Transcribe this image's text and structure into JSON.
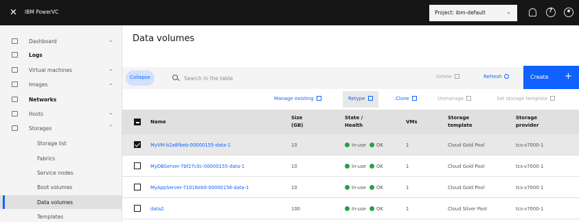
{
  "header": {
    "app_name": "IBM PowerVC",
    "project_label": "Project: ibm-default",
    "icons": [
      "close-icon",
      "notification-icon",
      "help-icon",
      "user-icon"
    ]
  },
  "sidebar": {
    "items": [
      {
        "label": "Dashboard",
        "icon": "dashboard-icon",
        "expandable": true
      },
      {
        "label": "Logs",
        "icon": "logs-icon",
        "expandable": false
      },
      {
        "label": "Virtual machines",
        "icon": "vm-icon",
        "expandable": true
      },
      {
        "label": "Images",
        "icon": "images-icon",
        "expandable": true
      },
      {
        "label": "Networks",
        "icon": "network-icon",
        "expandable": false
      },
      {
        "label": "Hosts",
        "icon": "hosts-icon",
        "expandable": true
      },
      {
        "label": "Storages",
        "icon": "storage-icon",
        "expandable": true,
        "expanded": true
      }
    ],
    "sub_items": [
      {
        "label": "Storage list"
      },
      {
        "label": "Fabrics"
      },
      {
        "label": "Service nodes"
      },
      {
        "label": "Boot volumes"
      },
      {
        "label": "Data volumes",
        "active": true
      },
      {
        "label": "Templates"
      }
    ]
  },
  "main": {
    "title": "Data volumes",
    "collect_label": "Collapse",
    "search_placeholder": "Search in the table",
    "delete_label": "Delete",
    "refresh_label": "Refresh",
    "create_label": "Create",
    "create_icon": "+",
    "actions": {
      "manage_existing": "Manage existing",
      "retype": "Retype",
      "clone": "Clone",
      "unmanage": "Unmanage",
      "set_storage_template": "Set storage template"
    }
  },
  "table": {
    "columns": [
      {
        "label": "Name"
      },
      {
        "label": "Size (GB)"
      },
      {
        "label": "State / Health"
      },
      {
        "label": "VMs"
      },
      {
        "label": "Storage template"
      },
      {
        "label": "Storage provider"
      }
    ],
    "rows": [
      {
        "name": "MyVM-b2a8fbeb-00000155-data-1",
        "size": "10",
        "state": "In-use",
        "health": "OK",
        "vms": "1",
        "template": "Cloud Gold Pool",
        "provider": "tcs-v7000-1",
        "selected": true
      },
      {
        "name": "MyDBServer-7bf27c0c-00000155-data-1",
        "size": "10",
        "state": "In-use",
        "health": "OK",
        "vms": "1",
        "template": "Cloud Gold Pool",
        "provider": "tcs-v7000-1",
        "selected": false
      },
      {
        "name": "MyAppServer-71016eb0-00000156-data-1",
        "size": "10",
        "state": "In-use",
        "health": "OK",
        "vms": "1",
        "template": "Cloud Gold Pool",
        "provider": "tcs-v7000-1",
        "selected": false
      },
      {
        "name": "data2",
        "size": "100",
        "state": "In-use",
        "health": "OK",
        "vms": "1",
        "template": "Cloud Silver Pool",
        "provider": "tcs-v7000-1",
        "selected": false
      }
    ]
  },
  "colors": {
    "accent": "#0f62fe",
    "topbar": "#161616",
    "ok_green": "#24a148"
  }
}
